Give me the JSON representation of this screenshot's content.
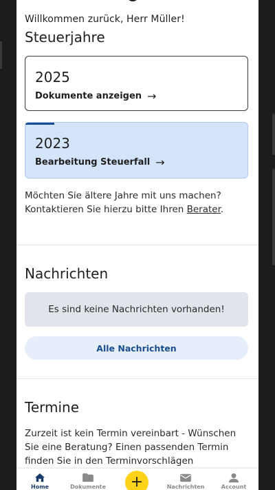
{
  "welcome": "Willkommen zurück, Herr Müller!",
  "tax_years": {
    "title": "Steuerjahre",
    "cards": [
      {
        "year": "2025",
        "link": "Dokumente anzeigen"
      },
      {
        "year": "2023",
        "link": "Bearbeitung Steuerfall",
        "progress": 0.13
      }
    ],
    "older_text": "Möchten Sie ältere Jahre mit uns machen? Kontaktieren Sie hierzu bitte Ihren ",
    "older_link": "Berater",
    "older_end": "."
  },
  "messages": {
    "title": "Nachrichten",
    "empty": "Es sind keine Nachrichten vorhanden!",
    "all_button": "Alle Nachrichten"
  },
  "appointments": {
    "title": "Termine",
    "text": "Zurzeit ist kein Termin vereinbart - Wünschen Sie eine Beratung? Einen passenden Termin finden Sie in den Terminvorschlägen"
  },
  "nav": {
    "home": "Home",
    "documents": "Dokumente",
    "add": "+",
    "messages": "Nachrichten",
    "account": "Account"
  },
  "colors": {
    "accent": "#1a4d8f",
    "active_card": "#d4e4fb",
    "fab": "#ffd31a"
  }
}
